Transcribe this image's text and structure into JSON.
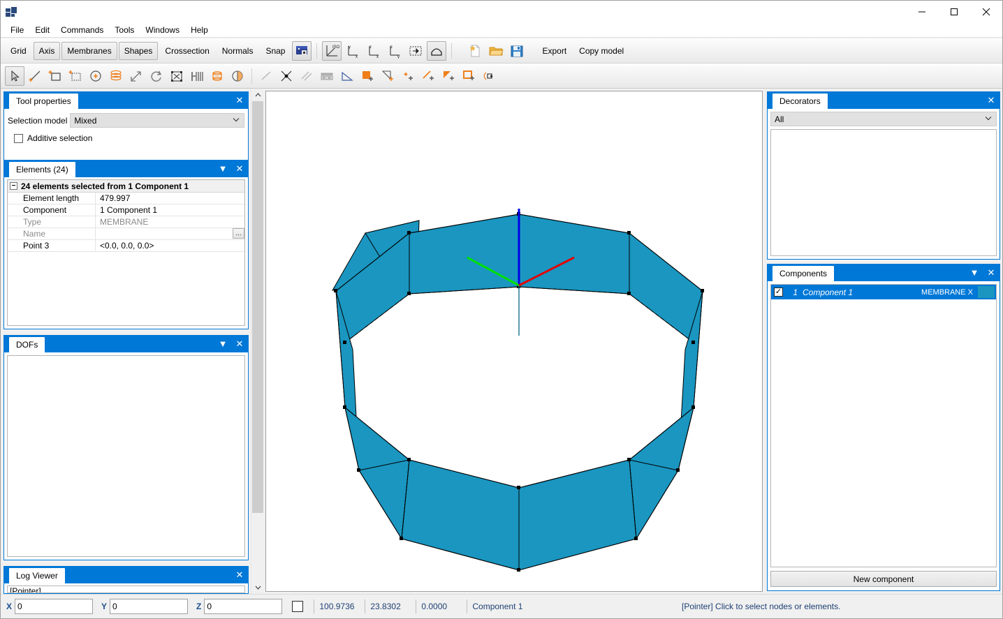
{
  "window": {
    "app_icon": "app-logo-icon",
    "title": "",
    "minimize": "—",
    "maximize": "☐",
    "close": "✕"
  },
  "menu": {
    "items": [
      "File",
      "Edit",
      "Commands",
      "Tools",
      "Windows",
      "Help"
    ]
  },
  "toolbar_view": {
    "buttons": [
      {
        "label": "Grid",
        "pressed": false
      },
      {
        "label": "Axis",
        "pressed": true
      },
      {
        "label": "Membranes",
        "pressed": true
      },
      {
        "label": "Shapes",
        "pressed": true
      },
      {
        "label": "Crossection",
        "pressed": false
      },
      {
        "label": "Normals",
        "pressed": false
      },
      {
        "label": "Snap",
        "pressed": false
      }
    ],
    "icon_buttons": [
      {
        "name": "lock-view-icon",
        "pressed": true
      },
      {
        "name": "iso-view-icon",
        "pressed": true
      },
      {
        "name": "front-view-zx-icon",
        "pressed": false
      },
      {
        "name": "top-view-zx-icon",
        "pressed": false
      },
      {
        "name": "side-view-zy-icon",
        "pressed": false
      },
      {
        "name": "fit-selection-icon",
        "pressed": false
      },
      {
        "name": "shape-view-icon",
        "pressed": true
      },
      {
        "name": "new-file-icon",
        "pressed": false
      },
      {
        "name": "open-folder-icon",
        "pressed": false
      },
      {
        "name": "save-disk-icon",
        "pressed": false
      }
    ],
    "export_label": "Export",
    "copy_model_label": "Copy model"
  },
  "toolbar_tools": {
    "icon_buttons": [
      {
        "name": "pointer-select-icon",
        "pressed": true
      },
      {
        "name": "add-line-icon",
        "pressed": false
      },
      {
        "name": "add-rectangle-icon",
        "pressed": false
      },
      {
        "name": "add-mesh-icon",
        "pressed": false
      },
      {
        "name": "add-node-icon",
        "pressed": false
      },
      {
        "name": "stack-layers-icon",
        "pressed": false
      },
      {
        "name": "move-icon",
        "pressed": false
      },
      {
        "name": "rotate-icon",
        "pressed": false
      },
      {
        "name": "scale-icon",
        "pressed": false
      },
      {
        "name": "array-copy-icon",
        "pressed": false
      },
      {
        "name": "revolve-icon",
        "pressed": false
      },
      {
        "name": "mirror-icon",
        "pressed": false
      },
      {
        "name": "line-snap-icon",
        "pressed": false
      },
      {
        "name": "intersection-icon",
        "pressed": false
      },
      {
        "name": "parallel-icon",
        "pressed": false
      },
      {
        "name": "support-icon",
        "pressed": false
      },
      {
        "name": "angle-icon",
        "pressed": false
      },
      {
        "name": "add-surface-icon",
        "pressed": false
      },
      {
        "name": "add-diagonal-icon",
        "pressed": false
      },
      {
        "name": "add-point-icon",
        "pressed": false
      },
      {
        "name": "add-edge-icon",
        "pressed": false
      },
      {
        "name": "add-triangle-icon",
        "pressed": false
      },
      {
        "name": "add-quad-icon",
        "pressed": false
      },
      {
        "name": "revolve-shape-icon",
        "pressed": false
      }
    ]
  },
  "tool_properties": {
    "tab": "Tool properties",
    "selection_model_label": "Selection model",
    "selection_model_value": "Mixed",
    "additive_selection_label": "Additive selection",
    "additive_selection_checked": false,
    "close": "✕"
  },
  "elements": {
    "tab": "Elements (24)",
    "collapse": "▼",
    "close": "✕",
    "group_header": "24 elements selected from 1 Component 1",
    "expander": "−",
    "rows": [
      {
        "key": "Element length",
        "value": "479.997",
        "dim": false,
        "ellipsis": false
      },
      {
        "key": "Component",
        "value": "1 Component 1",
        "dim": false,
        "ellipsis": false
      },
      {
        "key": "Type",
        "value": "MEMBRANE",
        "dim": true,
        "ellipsis": false
      },
      {
        "key": "Name",
        "value": "",
        "dim": true,
        "ellipsis": true
      },
      {
        "key": "Point 3",
        "value": "<0.0, 0.0, 0.0>",
        "dim": false,
        "ellipsis": false
      }
    ],
    "ellipsis_label": "..."
  },
  "dofs": {
    "tab": "DOFs",
    "collapse": "▼",
    "close": "✕"
  },
  "log_viewer": {
    "tab": "Log Viewer",
    "close": "✕",
    "first_line": "[Pointer]"
  },
  "decorators": {
    "tab": "Decorators",
    "close": "✕",
    "filter_value": "All"
  },
  "components": {
    "tab": "Components",
    "collapse": "▼",
    "close": "✕",
    "rows": [
      {
        "checked": true,
        "index": "1",
        "name": "Component 1",
        "type": "MEMBRANE X",
        "color": "#1a96c0"
      }
    ],
    "new_component_label": "New component",
    "check_glyph": "✓"
  },
  "viewport": {
    "background": "#ffffff",
    "membrane_color": "#1a96c0",
    "edge_color": "#000000",
    "axes": {
      "x_color": "#e40000",
      "y_color": "#00e000",
      "z_color": "#0000e6"
    },
    "shape": "octagonal-membrane-ring"
  },
  "statusbar": {
    "x_label": "X",
    "x_value": "0",
    "y_label": "Y",
    "y_value": "0",
    "z_label": "Z",
    "z_value": "0",
    "ortho_checked": false,
    "coord1": "100.9736",
    "coord2": "23.8302",
    "coord3": "0.0000",
    "component": "Component 1",
    "hint": "[Pointer] Click to select nodes or elements."
  }
}
